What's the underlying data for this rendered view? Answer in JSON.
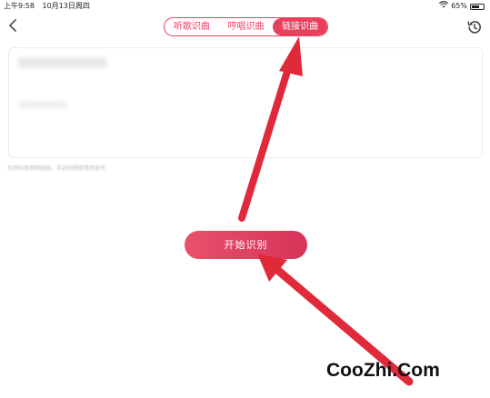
{
  "status_bar": {
    "time": "上午9:58",
    "date": "10月13日周四",
    "battery": "65%",
    "battery_level": 0.65
  },
  "nav": {
    "tabs": [
      {
        "label": "听歌识曲",
        "active": false
      },
      {
        "label": "哼唱识曲",
        "active": false
      },
      {
        "label": "链接识曲",
        "active": true
      }
    ]
  },
  "content": {
    "hint": "支持抖音视频链接，可识别视频里的音乐"
  },
  "actions": {
    "start_label": "开始识别"
  },
  "watermark": "CooZhi.Com",
  "colors": {
    "accent": "#e94060",
    "arrow": "#e02a3a"
  },
  "icons": [
    "back-chevron-icon",
    "history-clock-icon",
    "wifi-icon",
    "battery-icon"
  ]
}
